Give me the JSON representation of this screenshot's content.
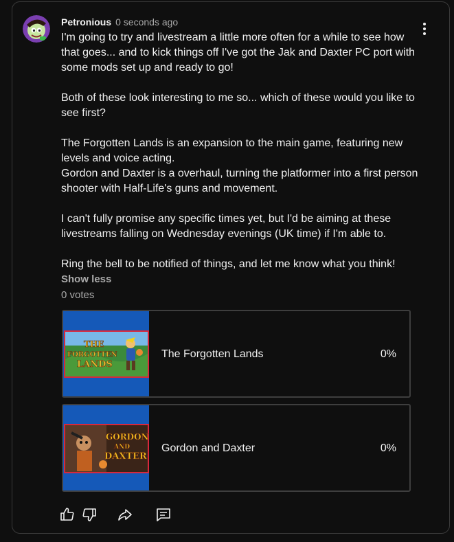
{
  "post": {
    "author": "Petronious",
    "timestamp": "0 seconds ago",
    "paragraphs": [
      "I'm going to try and livestream a little more often for a while to see how that goes... and to kick things off I've got the Jak and Daxter PC port with some mods set up and ready to go!",
      "Both of these look interesting to me so... which of these would you like to see first?",
      "The Forgotten Lands is an expansion to the main game, featuring new levels and voice acting.",
      "Gordon and Daxter is a overhaul, turning the platformer into a first person shooter with Half-Life's guns and movement.",
      "I can't fully promise any specific times yet, but I'd be aiming at these livestreams falling on Wednesday evenings (UK time) if I'm able to.",
      "Ring the bell to be notified of things, and let me know what you think!"
    ],
    "show_less": "Show less",
    "votes": "0 votes"
  },
  "poll": {
    "options": [
      {
        "label": "The Forgotten Lands",
        "percent": "0%",
        "thumb_art_text": "THE FORGOTTEN LANDS"
      },
      {
        "label": "Gordon and Daxter",
        "percent": "0%",
        "thumb_art_text": "GORDON AND DAXTER"
      }
    ]
  },
  "actions": {
    "like": "like-icon",
    "dislike": "dislike-icon",
    "share": "share-icon",
    "comment": "comment-icon"
  },
  "colors": {
    "background": "#0f0f0f",
    "border": "#3a3a3a",
    "thumb_blue": "#1559b8",
    "text": "#f1f1f1",
    "muted": "#aaaaaa"
  }
}
